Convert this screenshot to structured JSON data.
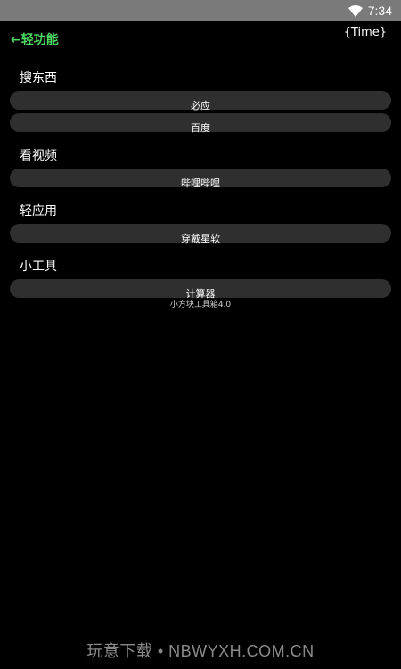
{
  "status_bar": {
    "time": "7:34",
    "wifi_icon": "wifi-icon"
  },
  "header": {
    "back_label": "←轻功能",
    "time_placeholder": "{Time}"
  },
  "sections": [
    {
      "title": "搜东西",
      "buttons": [
        "必应",
        "百度"
      ]
    },
    {
      "title": "看视频",
      "buttons": [
        "哔哩哔哩"
      ]
    },
    {
      "title": "轻应用",
      "buttons": [
        "穿戴星软"
      ]
    },
    {
      "title": "小工具",
      "buttons": [
        "计算器"
      ]
    }
  ],
  "footer": {
    "credit": "小方块工具箱4.0"
  },
  "watermark": {
    "text": "玩意下载 • NBWYXH.COM.CN"
  },
  "colors": {
    "background": "#000000",
    "status_bar": "#7a7a7a",
    "accent_green": "#4cd964",
    "button_bg": "#2f2f2f"
  }
}
